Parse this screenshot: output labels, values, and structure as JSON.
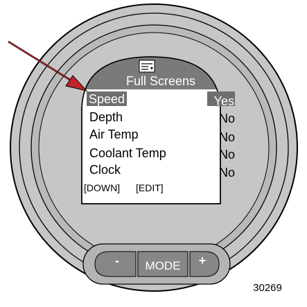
{
  "screen": {
    "title": "Full Screens",
    "icon": "screens-menu-icon",
    "items": [
      {
        "label": "Speed",
        "value": "Yes",
        "selected": true
      },
      {
        "label": "Depth",
        "value": "No",
        "selected": false
      },
      {
        "label": "Air Temp",
        "value": "No",
        "selected": false
      },
      {
        "label": "Coolant Temp",
        "value": "No",
        "selected": false
      },
      {
        "label": "Clock",
        "value": "No",
        "selected": false
      }
    ],
    "soft_keys": {
      "down": "[DOWN]",
      "edit": "[EDIT]"
    }
  },
  "buttons": {
    "minus": "-",
    "mode": "MODE",
    "plus": "+"
  },
  "figure_number": "30269",
  "colors": {
    "bezel": "#c6c6c6",
    "bezel_ring": "#b4b4b4",
    "screen_bg": "#ffffff",
    "header_bg": "#7a7a7a",
    "highlight_bg": "#6e6e6e",
    "highlight_text": "#ffffff",
    "arrow": "#c0252a"
  }
}
